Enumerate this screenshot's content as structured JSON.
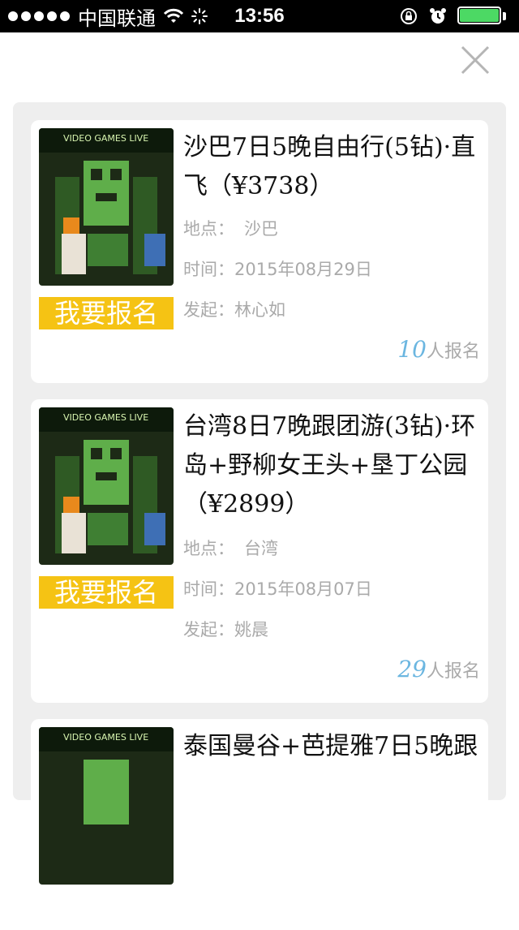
{
  "status_bar": {
    "carrier": "中国联通",
    "time": "13:56"
  },
  "cards": [
    {
      "title": "沙巴7日5晚自由行(5钻)·直飞（¥3738）",
      "location_label": "地点：",
      "location": "沙巴",
      "time_label": "时间：",
      "time": "2015年08月29日",
      "organizer_label": "发起：",
      "organizer": "林心如",
      "signup_label": "我要报名",
      "count": "10",
      "count_suffix": "人报名"
    },
    {
      "title": "台湾8日7晚跟团游(3钻)·环岛+野柳女王头+垦丁公园（¥2899）",
      "location_label": "地点：",
      "location": "台湾",
      "time_label": "时间：",
      "time": "2015年08月07日",
      "organizer_label": "发起：",
      "organizer": "姚晨",
      "signup_label": "我要报名",
      "count": "29",
      "count_suffix": "人报名"
    },
    {
      "title": "泰国曼谷+芭提雅7日5晚跟"
    }
  ],
  "poster_text": "VIDEO GAMES LIVE",
  "colors": {
    "accent_yellow": "#f5c314",
    "count_blue": "#6bb6e0",
    "panel_bg": "#eeeeee"
  }
}
